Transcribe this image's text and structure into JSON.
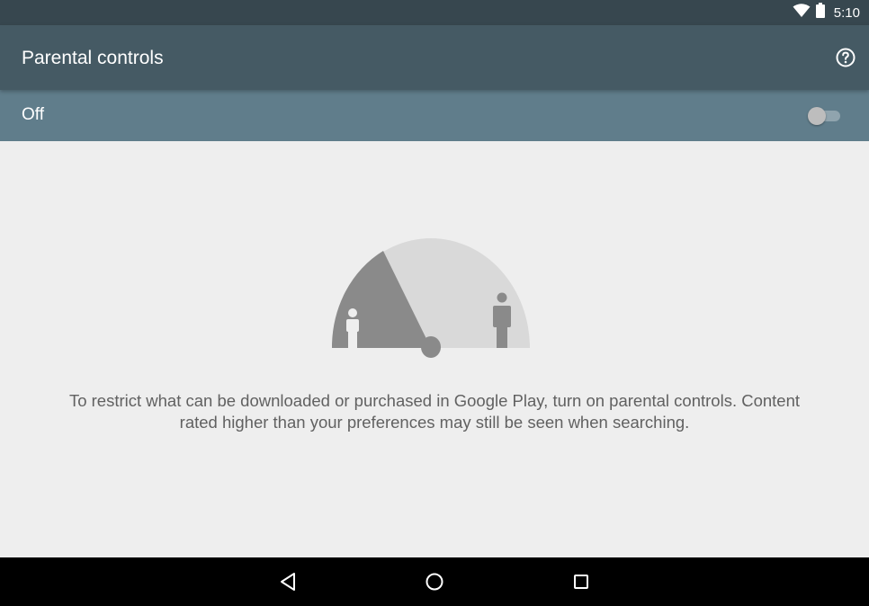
{
  "status_bar": {
    "time": "5:10",
    "icons": [
      "wifi-icon",
      "battery-icon"
    ]
  },
  "toolbar": {
    "title": "Parental controls",
    "help_icon": "help-circle-icon"
  },
  "switch_bar": {
    "label": "Off",
    "toggle_state": "off"
  },
  "main": {
    "description_line1": "To restrict what can be downloaded or purchased in Google Play, turn on parental controls. Content",
    "description_line2": "rated higher than your preferences may still be seen when searching."
  },
  "nav_bar": {
    "buttons": [
      "back-icon",
      "home-icon",
      "recents-icon"
    ]
  },
  "colors": {
    "status_bar": "#37474f",
    "toolbar": "#455a64",
    "switch_bar": "#607d8b",
    "background": "#eeeeee",
    "illustration_dark": "#8a8a8a",
    "illustration_light": "#d9d9d9"
  }
}
